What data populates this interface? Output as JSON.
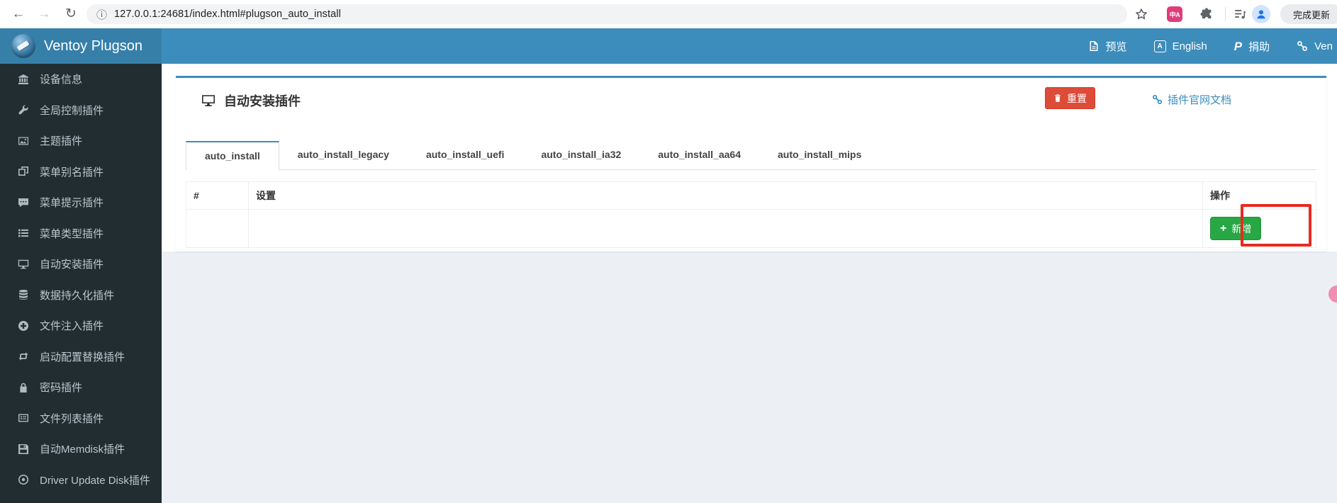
{
  "browser": {
    "back_icon": "←",
    "forward_icon": "→",
    "refresh_icon": "↻",
    "info_icon": "ⓘ",
    "url": "127.0.0.1:24681/index.html#plugson_auto_install",
    "translate_ext_glyph": "中A",
    "update_chip": "完成更新"
  },
  "header": {
    "brand": "Ventoy Plugson",
    "language_glyph": "A",
    "paypal_glyph": "P",
    "nav_items": [
      {
        "label": "预览",
        "icon": "preview-file-icon"
      },
      {
        "label": "English",
        "icon": "language-icon"
      },
      {
        "label": "捐助",
        "icon": "paypal-icon"
      },
      {
        "label": "Ven",
        "icon": "link-icon"
      }
    ]
  },
  "sidebar": {
    "items": [
      {
        "label": "设备信息",
        "icon": "bank-icon"
      },
      {
        "label": "全局控制插件",
        "icon": "wrench-icon"
      },
      {
        "label": "主题插件",
        "icon": "image-icon"
      },
      {
        "label": "菜单别名插件",
        "icon": "clone-icon"
      },
      {
        "label": "菜单提示插件",
        "icon": "comment-icon"
      },
      {
        "label": "菜单类型插件",
        "icon": "list-icon"
      },
      {
        "label": "自动安装插件",
        "icon": "desktop-icon"
      },
      {
        "label": "数据持久化插件",
        "icon": "database-icon"
      },
      {
        "label": "文件注入插件",
        "icon": "plus-circle-icon"
      },
      {
        "label": "启动配置替换插件",
        "icon": "retweet-icon"
      },
      {
        "label": "密码插件",
        "icon": "lock-icon"
      },
      {
        "label": "文件列表插件",
        "icon": "list-alt-icon"
      },
      {
        "label": "自动Memdisk插件",
        "icon": "floppy-icon"
      },
      {
        "label": "Driver Update Disk插件",
        "icon": "disc-icon"
      }
    ]
  },
  "main": {
    "title": "自动安装插件",
    "reset_label": "重置",
    "doc_link_label": "插件官网文档",
    "tabs": [
      {
        "label": "auto_install",
        "active": true
      },
      {
        "label": "auto_install_legacy",
        "active": false
      },
      {
        "label": "auto_install_uefi",
        "active": false
      },
      {
        "label": "auto_install_ia32",
        "active": false
      },
      {
        "label": "auto_install_aa64",
        "active": false
      },
      {
        "label": "auto_install_mips",
        "active": false
      }
    ],
    "table": {
      "col_index": "#",
      "col_settings": "设置",
      "col_actions": "操作",
      "add_plus": "+",
      "add_label": "新增"
    }
  },
  "colors": {
    "header_blue": "#3c8dbc",
    "logo_blue": "#367fa9",
    "sidebar_dark": "#222d32",
    "danger_red": "#dd4b39",
    "success_green": "#28a745",
    "link_blue": "#3c8dbc",
    "annotation_red": "#e8291f",
    "content_gray": "#ecf0f5"
  }
}
